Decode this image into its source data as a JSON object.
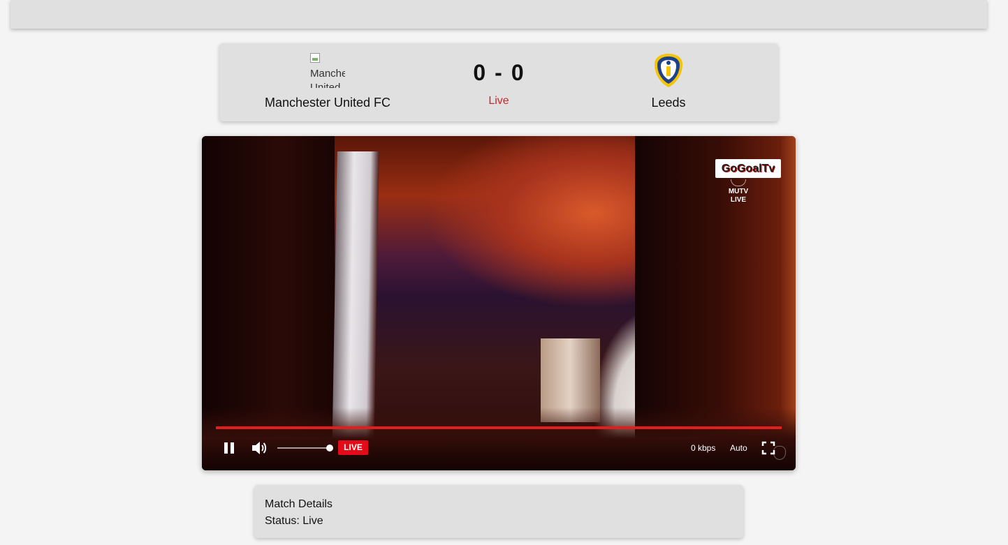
{
  "scoreboard": {
    "home_team": {
      "name": "Manchester United FC",
      "logo_alt": "Manchester United"
    },
    "away_team": {
      "name": "Leeds"
    },
    "home_score": "0",
    "separator": "-",
    "away_score": "0",
    "status": "Live"
  },
  "player": {
    "watermark": "GoGoalTv",
    "channel_name": "MUTV",
    "channel_status": "LIVE",
    "live_badge": "LIVE",
    "bitrate": "0 kbps",
    "quality": "Auto",
    "progress_fraction": 1.0,
    "volume_fraction": 1.0
  },
  "details": {
    "title": "Match Details",
    "status_label": "Status: Live"
  },
  "colors": {
    "live_red": "#c62828",
    "live_badge_bg": "#e30b17",
    "progress_red": "#e01e1e",
    "panel_bg": "#e0e0e0"
  },
  "icons": {
    "pause": "pause-icon",
    "volume": "volume-icon",
    "fullscreen": "fullscreen-icon",
    "home_logo": "broken-image-icon",
    "away_logo": "leeds-crest-icon"
  }
}
